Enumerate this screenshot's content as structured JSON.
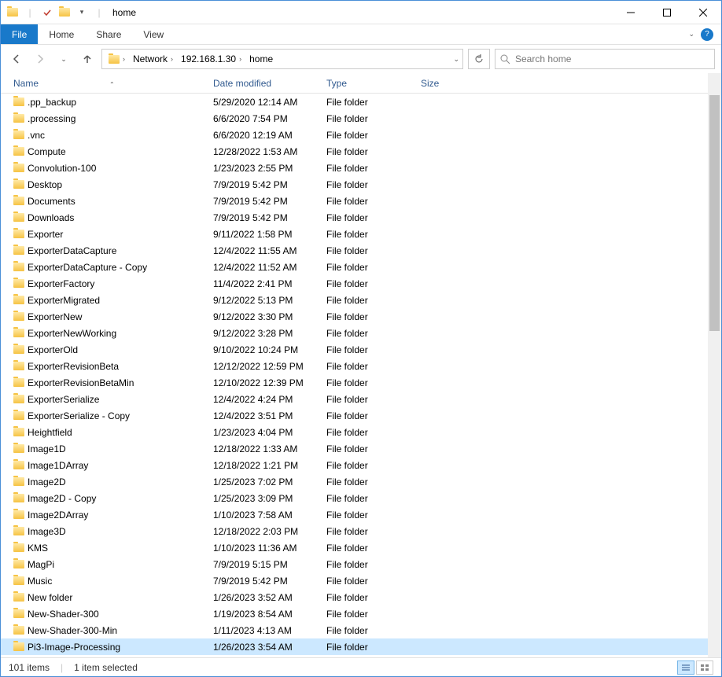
{
  "window": {
    "title": "home"
  },
  "tabs": {
    "file": "File",
    "home": "Home",
    "share": "Share",
    "view": "View"
  },
  "address": {
    "segments": [
      "Network",
      "192.168.1.30",
      "home"
    ]
  },
  "search": {
    "placeholder": "Search home"
  },
  "columns": {
    "name": "Name",
    "date": "Date modified",
    "type": "Type",
    "size": "Size"
  },
  "files": [
    {
      "name": ".pp_backup",
      "date": "5/29/2020 12:14 AM",
      "type": "File folder",
      "size": ""
    },
    {
      "name": ".processing",
      "date": "6/6/2020 7:54 PM",
      "type": "File folder",
      "size": ""
    },
    {
      "name": ".vnc",
      "date": "6/6/2020 12:19 AM",
      "type": "File folder",
      "size": ""
    },
    {
      "name": "Compute",
      "date": "12/28/2022 1:53 AM",
      "type": "File folder",
      "size": ""
    },
    {
      "name": "Convolution-100",
      "date": "1/23/2023 2:55 PM",
      "type": "File folder",
      "size": ""
    },
    {
      "name": "Desktop",
      "date": "7/9/2019 5:42 PM",
      "type": "File folder",
      "size": ""
    },
    {
      "name": "Documents",
      "date": "7/9/2019 5:42 PM",
      "type": "File folder",
      "size": ""
    },
    {
      "name": "Downloads",
      "date": "7/9/2019 5:42 PM",
      "type": "File folder",
      "size": ""
    },
    {
      "name": "Exporter",
      "date": "9/11/2022 1:58 PM",
      "type": "File folder",
      "size": ""
    },
    {
      "name": "ExporterDataCapture",
      "date": "12/4/2022 11:55 AM",
      "type": "File folder",
      "size": ""
    },
    {
      "name": "ExporterDataCapture - Copy",
      "date": "12/4/2022 11:52 AM",
      "type": "File folder",
      "size": ""
    },
    {
      "name": "ExporterFactory",
      "date": "11/4/2022 2:41 PM",
      "type": "File folder",
      "size": ""
    },
    {
      "name": "ExporterMigrated",
      "date": "9/12/2022 5:13 PM",
      "type": "File folder",
      "size": ""
    },
    {
      "name": "ExporterNew",
      "date": "9/12/2022 3:30 PM",
      "type": "File folder",
      "size": ""
    },
    {
      "name": "ExporterNewWorking",
      "date": "9/12/2022 3:28 PM",
      "type": "File folder",
      "size": ""
    },
    {
      "name": "ExporterOld",
      "date": "9/10/2022 10:24 PM",
      "type": "File folder",
      "size": ""
    },
    {
      "name": "ExporterRevisionBeta",
      "date": "12/12/2022 12:59 PM",
      "type": "File folder",
      "size": ""
    },
    {
      "name": "ExporterRevisionBetaMin",
      "date": "12/10/2022 12:39 PM",
      "type": "File folder",
      "size": ""
    },
    {
      "name": "ExporterSerialize",
      "date": "12/4/2022 4:24 PM",
      "type": "File folder",
      "size": ""
    },
    {
      "name": "ExporterSerialize - Copy",
      "date": "12/4/2022 3:51 PM",
      "type": "File folder",
      "size": ""
    },
    {
      "name": "Heightfield",
      "date": "1/23/2023 4:04 PM",
      "type": "File folder",
      "size": ""
    },
    {
      "name": "Image1D",
      "date": "12/18/2022 1:33 AM",
      "type": "File folder",
      "size": ""
    },
    {
      "name": "Image1DArray",
      "date": "12/18/2022 1:21 PM",
      "type": "File folder",
      "size": ""
    },
    {
      "name": "Image2D",
      "date": "1/25/2023 7:02 PM",
      "type": "File folder",
      "size": ""
    },
    {
      "name": "Image2D - Copy",
      "date": "1/25/2023 3:09 PM",
      "type": "File folder",
      "size": ""
    },
    {
      "name": "Image2DArray",
      "date": "1/10/2023 7:58 AM",
      "type": "File folder",
      "size": ""
    },
    {
      "name": "Image3D",
      "date": "12/18/2022 2:03 PM",
      "type": "File folder",
      "size": ""
    },
    {
      "name": "KMS",
      "date": "1/10/2023 11:36 AM",
      "type": "File folder",
      "size": ""
    },
    {
      "name": "MagPi",
      "date": "7/9/2019 5:15 PM",
      "type": "File folder",
      "size": ""
    },
    {
      "name": "Music",
      "date": "7/9/2019 5:42 PM",
      "type": "File folder",
      "size": ""
    },
    {
      "name": "New folder",
      "date": "1/26/2023 3:52 AM",
      "type": "File folder",
      "size": ""
    },
    {
      "name": "New-Shader-300",
      "date": "1/19/2023 8:54 AM",
      "type": "File folder",
      "size": ""
    },
    {
      "name": "New-Shader-300-Min",
      "date": "1/11/2023 4:13 AM",
      "type": "File folder",
      "size": ""
    },
    {
      "name": "Pi3-Image-Processing",
      "date": "1/26/2023 3:54 AM",
      "type": "File folder",
      "size": "",
      "selected": true
    }
  ],
  "status": {
    "items": "101 items",
    "selected": "1 item selected"
  }
}
